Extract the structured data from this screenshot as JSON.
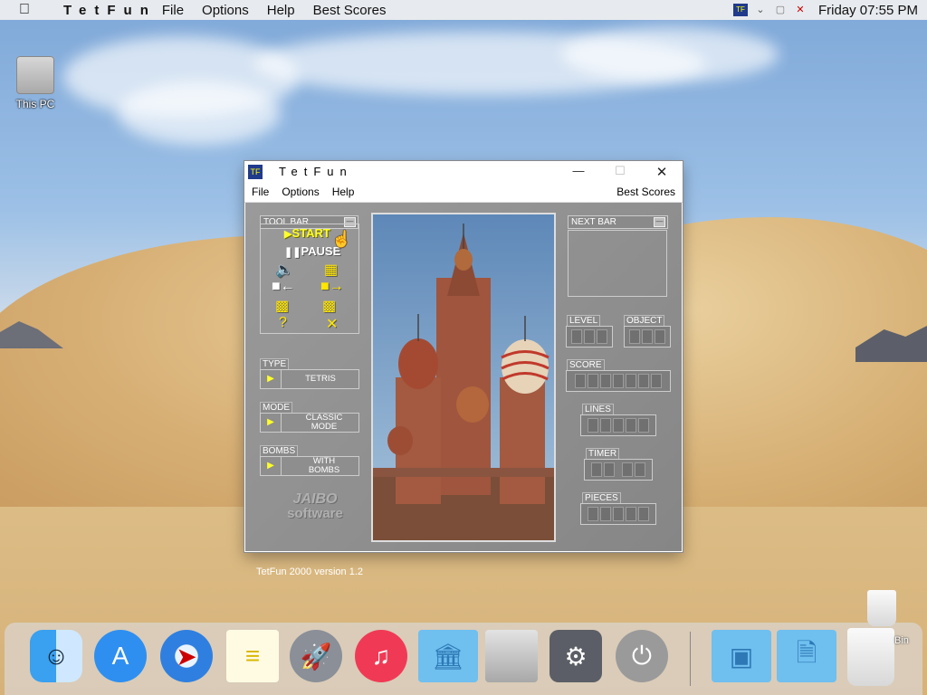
{
  "menubar": {
    "app_name": "TetFun",
    "items": [
      "File",
      "Options",
      "Help",
      "Best Scores"
    ],
    "clock": "Friday 07:55 PM"
  },
  "desktop": {
    "icon_label": "This PC"
  },
  "window": {
    "title": "TetFun",
    "menu": {
      "file": "File",
      "options": "Options",
      "help": "Help",
      "best_scores": "Best Scores"
    },
    "toolbar": {
      "title": "TOOL BAR",
      "start": "START",
      "pause": "PAUSE"
    },
    "type": {
      "label": "TYPE",
      "value": "TETRIS"
    },
    "mode": {
      "label": "MODE",
      "value": "CLASSIC MODE"
    },
    "bombs": {
      "label": "BOMBS",
      "value": "WITH BOMBS"
    },
    "logo": {
      "line1": "JAIBO",
      "line2": "software"
    },
    "version": "TetFun 2000 version 1.2",
    "next_bar": {
      "title": "NEXT BAR"
    },
    "stats": {
      "level": "LEVEL",
      "object": "OBJECT",
      "score": "SCORE",
      "lines": "LINES",
      "timer": "TIMER",
      "pieces": "PIECES"
    }
  },
  "dock": {
    "bin_label": "Bin"
  }
}
